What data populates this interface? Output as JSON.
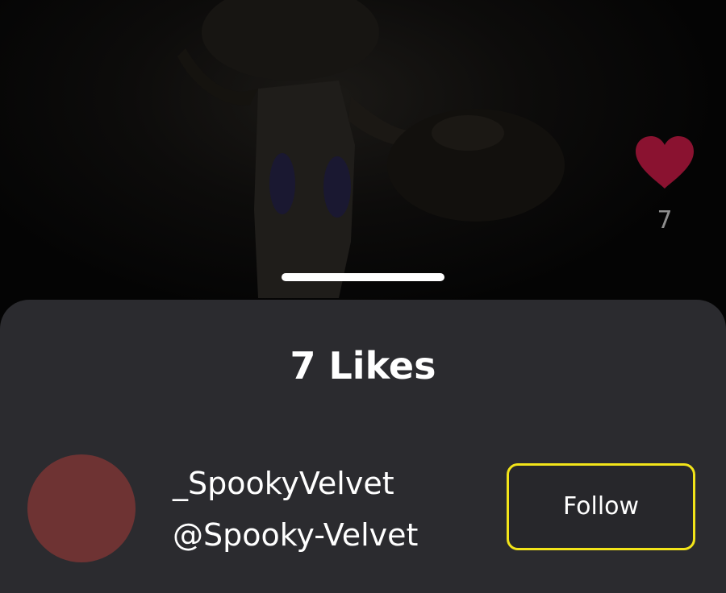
{
  "video": {
    "like_count": "7",
    "like_icon": "heart-icon",
    "like_color": "#8a1230"
  },
  "likes_sheet": {
    "title": "7 Likes",
    "users": [
      {
        "display_name": "_SpookyVelvet",
        "handle": "@Spooky-Velvet",
        "avatar_color": "#6e3333",
        "follow_label": "Follow"
      }
    ]
  },
  "colors": {
    "sheet_background": "#2b2b2f",
    "focus_outline": "#f2e419"
  }
}
